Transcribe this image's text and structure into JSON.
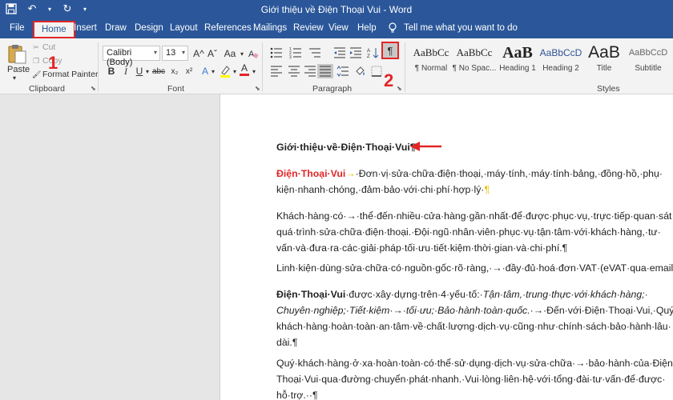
{
  "window": {
    "title": "Giới thiệu về Điện Thoại Vui  -  Word"
  },
  "tabs": [
    {
      "label": "File"
    },
    {
      "label": "Home"
    },
    {
      "label": "Insert"
    },
    {
      "label": "Draw"
    },
    {
      "label": "Design"
    },
    {
      "label": "Layout"
    },
    {
      "label": "References"
    },
    {
      "label": "Mailings"
    },
    {
      "label": "Review"
    },
    {
      "label": "View"
    },
    {
      "label": "Help"
    }
  ],
  "tell_me": "Tell me what you want to do",
  "ribbon": {
    "clipboard": {
      "paste": "Paste",
      "cut": "Cut",
      "copy": "Copy",
      "format_painter": "Format Painter",
      "group_label": "Clipboard"
    },
    "font": {
      "name": "Calibri (Body)",
      "size": "13",
      "grow": "A^",
      "shrink": "Aˇ",
      "case": "Aa",
      "bold": "B",
      "italic": "I",
      "underline": "U",
      "strike": "abc",
      "subscript": "x₂",
      "superscript": "x²",
      "group_label": "Font"
    },
    "paragraph": {
      "show_hide": "¶",
      "group_label": "Paragraph"
    },
    "styles": {
      "items": [
        {
          "sample": "AaBbCc",
          "name": "¶ Normal"
        },
        {
          "sample": "AaBbCc",
          "name": "¶ No Spac..."
        },
        {
          "sample": "AaB",
          "name": "Heading 1"
        },
        {
          "sample": "AaBbCcD",
          "name": "Heading 2"
        },
        {
          "sample": "AaB",
          "name": "Title"
        },
        {
          "sample": "AaBbCcD",
          "name": "Subtitle"
        }
      ],
      "group_label": "Styles"
    }
  },
  "annotations": {
    "step1": "1",
    "step2": "2"
  },
  "colors": {
    "brand": "#2b579a",
    "highlight_red": "#e32526",
    "font_color_bar": "#e32526"
  },
  "document": {
    "heading": "Giới·thiệu·về·Điện·Thoại·Vui¶",
    "p1": {
      "brand": "Điện·Thoại·Vui",
      "tab_mark": "→",
      "line1": "·Đơn·vị·sửa·chữa·điện·thoại,·máy·tính,·máy·tính·bảng,·đồng·hồ,·phụ·",
      "line2": "kiện·nhanh·chóng,·đảm·bảo·với·chi·phí·hợp·lý·",
      "end_mark": "¶"
    },
    "p2": [
      "Khách·hàng·có·→·thể·đến·nhiều·cửa·hàng·gần·nhất·để·được·phục·vụ,·trực·tiếp·quan·sát·",
      "quá·trình·sửa·chữa·điện·thoại.·Đội·ngũ·nhân·viên·phục·vụ·tận·tâm·với·khách·hàng,·tư·",
      "vấn·và·đưa·ra·các·giải·pháp·tối·ưu·tiết·kiệm·thời·gian·và·chi·phí.¶"
    ],
    "p3": "Linh·kiện·dùng·sửa·chữa·có·nguồn·gốc·rõ·ràng,·→·đầy·đủ·hoá·đơn·VAT·(eVAT·qua·email).¶",
    "p4": {
      "brand": "Điện·Thoại·Vui",
      "intro": "·được·xây·dựng·trên·4·yếu·tố:·",
      "italic1": "Tận·tâm,·trung·thực·với·khách·hàng;·",
      "italic2": "Chuyên·nghiệp;·Tiết·kiệm·→·tối·ưu;·Bảo·hành·toàn·quốc.",
      "rest2": "·→·Đến·với·Điện·Thoại·Vui,·Quý·",
      "line3": "khách·hàng·hoàn·toàn·an·tâm·về·chất·lượng·dịch·vụ·cũng·như·chính·sách·bảo·hành·lâu·",
      "line4": "dài.¶"
    },
    "p5": [
      "Quý·khách·hàng·ở·xa·hoàn·toàn·có·thể·sử·dụng·dịch·vụ·sửa·chữa·→·bảo·hành·của·Điện·",
      "Thoại·Vui·qua·đường·chuyển·phát·nhanh.·Vui·lòng·liên·hệ·với·tổng·đài·tư·vấn·để·được·",
      "hỗ·trợ.··¶"
    ]
  }
}
